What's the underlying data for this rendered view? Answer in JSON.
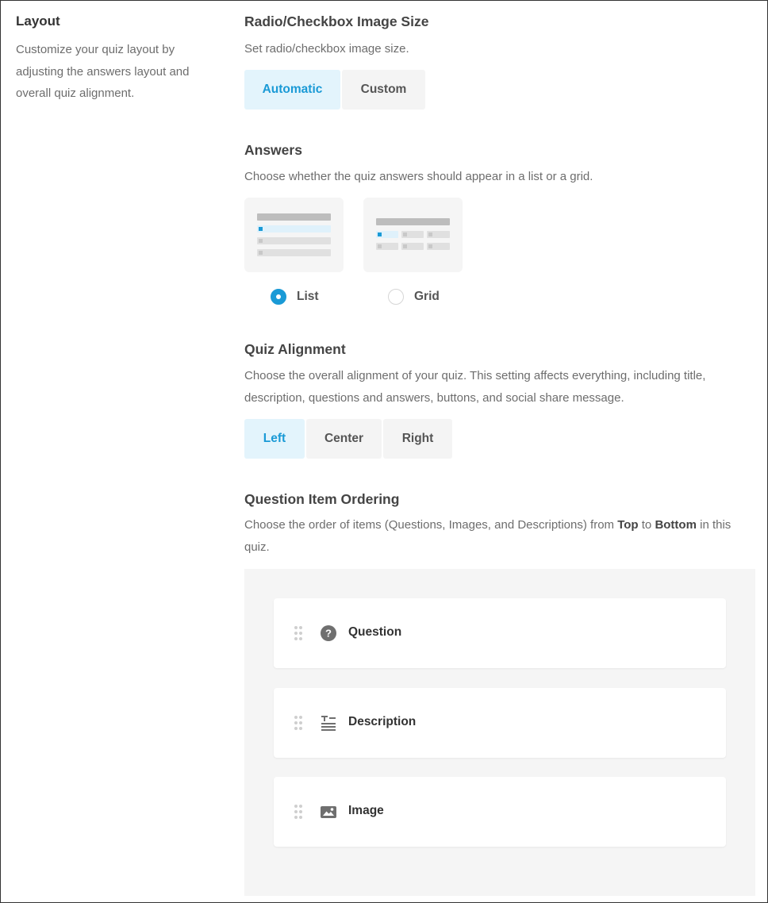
{
  "sidebar": {
    "title": "Layout",
    "description": "Customize your quiz layout by adjusting the answers layout and overall quiz alignment."
  },
  "image_size": {
    "title": "Radio/Checkbox Image Size",
    "description": "Set radio/checkbox image size.",
    "options": [
      "Automatic",
      "Custom"
    ],
    "selected": "Automatic"
  },
  "answers": {
    "title": "Answers",
    "description": "Choose whether the quiz answers should appear in a list or a grid.",
    "options": [
      {
        "label": "List",
        "checked": true,
        "icon": "list-layout-preview-icon"
      },
      {
        "label": "Grid",
        "checked": false,
        "icon": "grid-layout-preview-icon"
      }
    ]
  },
  "alignment": {
    "title": "Quiz Alignment",
    "description": "Choose the overall alignment of your quiz. This setting affects everything, including title, description, questions and answers, buttons, and social share message.",
    "options": [
      "Left",
      "Center",
      "Right"
    ],
    "selected": "Left"
  },
  "ordering": {
    "title": "Question Item Ordering",
    "description_parts": [
      "Choose the order of items (Questions, Images, and Descriptions) from ",
      "Top",
      " to ",
      "Bottom",
      " in this quiz."
    ],
    "items": [
      {
        "label": "Question",
        "icon": "question-circle-icon"
      },
      {
        "label": "Description",
        "icon": "text-description-icon"
      },
      {
        "label": "Image",
        "icon": "image-icon"
      }
    ]
  },
  "colors": {
    "accent": "#1a9ad6",
    "active_bg": "#e3f4fc",
    "panel_bg": "#f5f5f5"
  }
}
